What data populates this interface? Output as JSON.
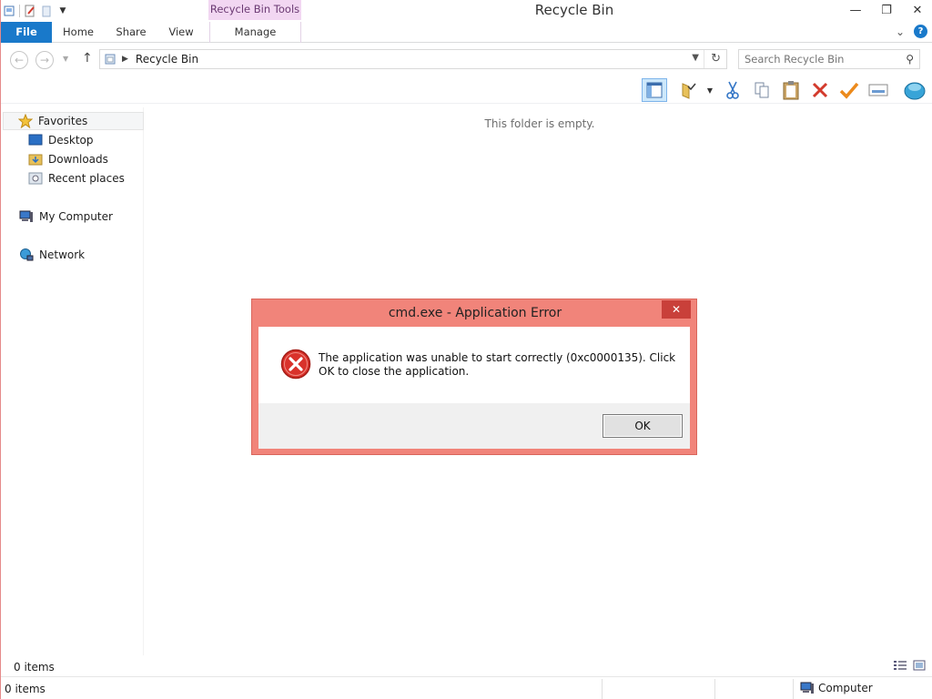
{
  "window": {
    "title": "Recycle Bin",
    "context_tab": "Recycle Bin Tools",
    "controls": {
      "minimize": "—",
      "restore": "❐",
      "close": "✕"
    }
  },
  "ribbon": {
    "tabs": [
      {
        "label": "File"
      },
      {
        "label": "Home"
      },
      {
        "label": "Share"
      },
      {
        "label": "View"
      },
      {
        "label": "Manage"
      }
    ],
    "help_icon": "?",
    "expand_icon": "⌄"
  },
  "address": {
    "path": "Recycle Bin",
    "search_placeholder": "Search Recycle Bin"
  },
  "navigation": {
    "favorites": "Favorites",
    "items": [
      {
        "label": "Desktop"
      },
      {
        "label": "Downloads"
      },
      {
        "label": "Recent places"
      }
    ],
    "computer": "My Computer",
    "network": "Network"
  },
  "content": {
    "empty_message": "This folder is empty."
  },
  "status": {
    "inner_count": "0 items",
    "bottom_count": "0 items",
    "location": "Computer"
  },
  "dialog": {
    "title": "cmd.exe - Application Error",
    "close_glyph": "✕",
    "message": "The application was unable to start correctly (0xc0000135). Click OK to close the application.",
    "ok_label": "OK"
  },
  "colors": {
    "file_tab": "#1979ca",
    "context_tab": "#f2d7f2",
    "dialog_frame": "#f1847a",
    "dialog_close": "#c9403a"
  }
}
